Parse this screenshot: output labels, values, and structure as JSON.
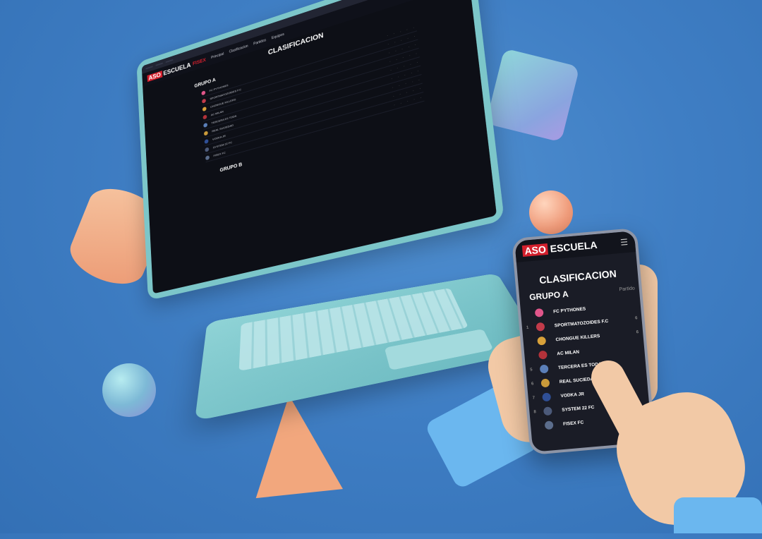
{
  "laptop": {
    "browser_tabs": [
      "",
      "",
      ""
    ],
    "logo_aso": "ASO",
    "logo_escuela": "ESCUELA",
    "logo_extra": "FISEX",
    "nav": [
      "Principal",
      "Clasificacion",
      "Partidos",
      "Equipos"
    ],
    "page_title": "CLASIFICACION",
    "groups": [
      {
        "title": "GRUPO A",
        "rows": [
          "FC PYTHONES",
          "SPORTMATOZOIDES F.C",
          "CHONGUE KILLERS",
          "AC MILAN",
          "TERCERA ES TODA",
          "REAL SUCIEDAD",
          "VODKA JR",
          "SYSTEM 22 FC",
          "FISEX FC",
          "",
          ""
        ]
      },
      {
        "title": "GRUPO B",
        "rows": [
          "",
          "",
          "",
          "",
          "",
          "",
          "",
          ""
        ]
      }
    ]
  },
  "phone": {
    "logo_aso": "ASO",
    "logo_escuela": "ESCUELA",
    "menu_icon": "hamburger-icon",
    "title": "CLASIFICACION",
    "group_title": "GRUPO A",
    "points_header": "Partido",
    "teams": [
      {
        "pos": "",
        "name": "FC PYTHONES",
        "val": "",
        "color": "#e0568a"
      },
      {
        "pos": "1",
        "name": "SPORTMATOZOIDES F.C",
        "val": "6",
        "color": "#c23b4a"
      },
      {
        "pos": "",
        "name": "CHONGUE KILLERS",
        "val": "6",
        "color": "#d8a13a"
      },
      {
        "pos": "",
        "name": "AC MILAN",
        "val": "",
        "color": "#b3323a"
      },
      {
        "pos": "5",
        "name": "TERCERA ES TODA",
        "val": "",
        "color": "#5b7fb8"
      },
      {
        "pos": "6",
        "name": "REAL SUCIEDAD",
        "val": "",
        "color": "#c99a3a"
      },
      {
        "pos": "7",
        "name": "VODKA JR",
        "val": "",
        "color": "#2f4f96"
      },
      {
        "pos": "8",
        "name": "SYSTEM 22 FC",
        "val": "",
        "color": "#4c5a7a"
      },
      {
        "pos": "",
        "name": "FISEX FC",
        "val": "",
        "color": "#5b6d8c"
      }
    ]
  }
}
